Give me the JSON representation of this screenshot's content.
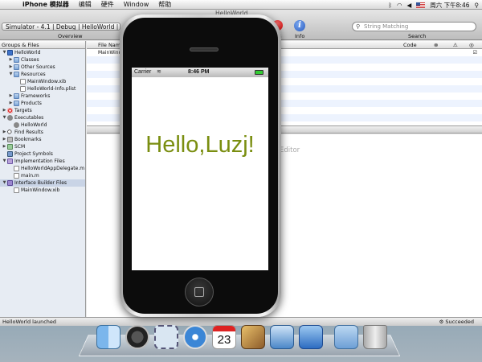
{
  "menubar": {
    "app_name": "iPhone 模拟器",
    "items": [
      "编辑",
      "硬件",
      "Window",
      "帮助"
    ],
    "clock": "周六 下午8:46"
  },
  "window": {
    "title": "HelloWorld",
    "overview_value": "Simulator - 4.1 | Debug | HelloWorld | Hell...",
    "overview_label": "Overview",
    "tasks_label": "sks",
    "info_label": "Info",
    "search_placeholder": "String Matching",
    "search_label": "Search"
  },
  "sidebar": {
    "header": "Groups & Files",
    "items": [
      {
        "label": "HelloWorld",
        "indent": 0,
        "icon": "proj",
        "tri": "▼"
      },
      {
        "label": "Classes",
        "indent": 1,
        "icon": "folder",
        "tri": "▶"
      },
      {
        "label": "Other Sources",
        "indent": 1,
        "icon": "folder",
        "tri": "▶"
      },
      {
        "label": "Resources",
        "indent": 1,
        "icon": "folder",
        "tri": "▼"
      },
      {
        "label": "MainWindow.xib",
        "indent": 2,
        "icon": "file",
        "tri": ""
      },
      {
        "label": "HelloWorld-Info.plist",
        "indent": 2,
        "icon": "file",
        "tri": ""
      },
      {
        "label": "Frameworks",
        "indent": 1,
        "icon": "folder",
        "tri": "▶"
      },
      {
        "label": "Products",
        "indent": 1,
        "icon": "folder",
        "tri": "▶"
      },
      {
        "label": "Targets",
        "indent": 0,
        "icon": "target",
        "tri": "▶"
      },
      {
        "label": "Executables",
        "indent": 0,
        "icon": "gear",
        "tri": "▼"
      },
      {
        "label": "HelloWorld",
        "indent": 1,
        "icon": "gear",
        "tri": ""
      },
      {
        "label": "Find Results",
        "indent": 0,
        "icon": "mag2",
        "tri": "▶"
      },
      {
        "label": "Bookmarks",
        "indent": 0,
        "icon": "bm",
        "tri": "▶"
      },
      {
        "label": "SCM",
        "indent": 0,
        "icon": "scm",
        "tri": "▶"
      },
      {
        "label": "Project Symbols",
        "indent": 0,
        "icon": "sym",
        "tri": ""
      },
      {
        "label": "Implementation Files",
        "indent": 0,
        "icon": "impl",
        "tri": "▼"
      },
      {
        "label": "HelloWorldAppDelegate.m",
        "indent": 1,
        "icon": "file",
        "tri": ""
      },
      {
        "label": "main.m",
        "indent": 1,
        "icon": "file",
        "tri": ""
      },
      {
        "label": "Interface Builder Files",
        "indent": 0,
        "icon": "ib",
        "tri": "▼",
        "selected": true
      },
      {
        "label": "MainWindow.xib",
        "indent": 1,
        "icon": "file",
        "tri": ""
      }
    ]
  },
  "filelist": {
    "col_filename": "File Nam",
    "col_code": "Code",
    "rows": [
      "MainWindo"
    ]
  },
  "editor": {
    "hint": "Editor"
  },
  "status": {
    "left": "HelloWorld launched",
    "right": "Succeeded"
  },
  "simulator": {
    "carrier": "Carrier",
    "time": "8:46 PM",
    "hello_text": "Hello,Luzj!",
    "text_color": "#7a8e10"
  },
  "dock": {
    "calendar_day": "23"
  }
}
